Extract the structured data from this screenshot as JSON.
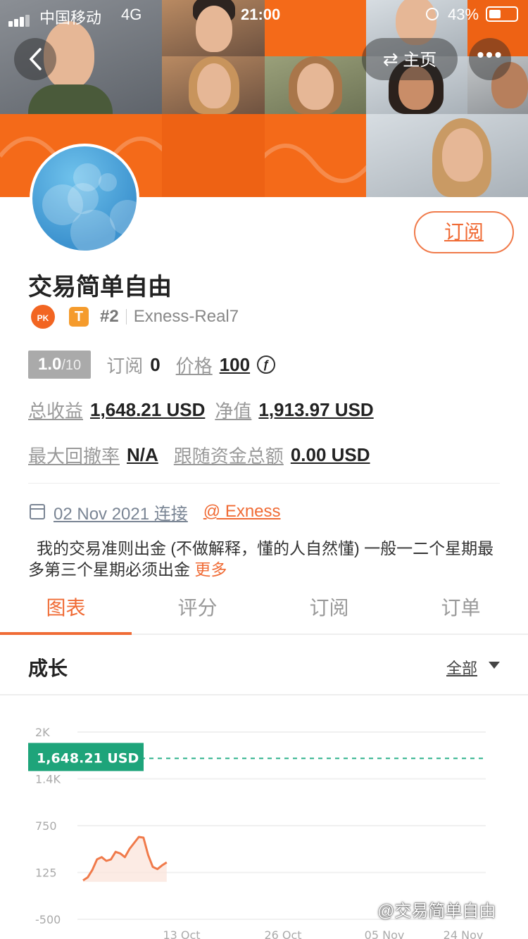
{
  "status_bar": {
    "carrier": "中国移动",
    "network": "4G",
    "time": "21:00",
    "battery": "43%"
  },
  "nav": {
    "back_icon": "chevron-left-icon",
    "home_label": "主页",
    "more_icon": "more-dots-icon"
  },
  "profile": {
    "name": "交易简单自由",
    "subscribe_label": "订阅",
    "pk_badge": "PK",
    "tier_badge": "T",
    "rank": "#2",
    "account": "Exness-Real7",
    "rating": "1.0",
    "rating_max": "/10",
    "subscriptions_label": "订阅",
    "subscriptions_value": "0",
    "price_label": "价格",
    "price_value": "100",
    "currency_icon": "coin-icon",
    "total_profit_label": "总收益",
    "total_profit_value": "1,648.21 USD",
    "equity_label": "净值",
    "equity_value": "1,913.97 USD",
    "max_drawdown_label": "最大回撤率",
    "max_drawdown_value": "N/A",
    "follow_funds_label": "跟随资金总额",
    "follow_funds_value": "0.00 USD",
    "joined_date": "02 Nov 2021 连接",
    "broker": "@ Exness",
    "description": "我的交易准则出金 (不做解释，懂的人自然懂) 一般一二个星期最多第三个星期必须出金",
    "more_label": "更多"
  },
  "tabs": [
    {
      "label": "图表",
      "active": true
    },
    {
      "label": "评分",
      "active": false
    },
    {
      "label": "订阅",
      "active": false
    },
    {
      "label": "订单",
      "active": false
    }
  ],
  "section": {
    "title": "成长",
    "filter_label": "全部"
  },
  "chart_data": {
    "type": "area",
    "y_ticks": [
      "2K",
      "1.4K",
      "750",
      "125",
      "-500"
    ],
    "x_ticks": [
      "13 Oct",
      "26 Oct",
      "05 Nov",
      "24 Nov"
    ],
    "ylim": [
      -500,
      2000
    ],
    "current_label": "1,648.21 USD",
    "current_value": 1648.21,
    "series": [
      {
        "x": [
          0,
          1,
          2,
          3,
          4,
          5,
          6,
          7,
          8,
          9,
          10,
          11,
          12,
          13,
          14,
          15,
          16,
          17,
          18
        ],
        "values": [
          20,
          60,
          160,
          300,
          330,
          280,
          300,
          400,
          380,
          330,
          440,
          520,
          600,
          590,
          360,
          200,
          170,
          220,
          260
        ]
      }
    ],
    "colors": {
      "line": "#f07a4a",
      "fill": "#fbe2d8",
      "label": "#1ea47a",
      "dashed": "#2bb08a"
    }
  },
  "watermark": "@交易简单自由"
}
